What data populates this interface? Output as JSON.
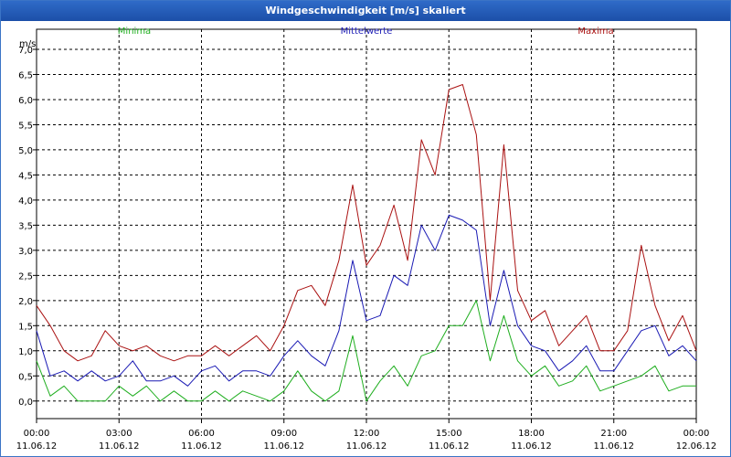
{
  "window": {
    "title": "Windgeschwindigkeit [m/s] skaliert"
  },
  "chart_data": {
    "type": "line",
    "title": "Windgeschwindigkeit [m/s] skaliert",
    "ylabel": "m/s",
    "xlabel": "",
    "xlim": [
      0,
      24
    ],
    "ylim": [
      -0.35,
      7.4
    ],
    "grid": true,
    "legend_placement": "top",
    "y_ticks": [
      "0,0",
      "0,5",
      "1,0",
      "1,5",
      "2,0",
      "2,5",
      "3,0",
      "3,5",
      "4,0",
      "4,5",
      "5,0",
      "5,5",
      "6,0",
      "6,5",
      "7,0"
    ],
    "y_tick_values": [
      0,
      0.5,
      1,
      1.5,
      2,
      2.5,
      3,
      3.5,
      4,
      4.5,
      5,
      5.5,
      6,
      6.5,
      7
    ],
    "x_ticks": [
      {
        "time": "00:00",
        "date": "11.06.12",
        "hour": 0
      },
      {
        "time": "03:00",
        "date": "11.06.12",
        "hour": 3
      },
      {
        "time": "06:00",
        "date": "11.06.12",
        "hour": 6
      },
      {
        "time": "09:00",
        "date": "11.06.12",
        "hour": 9
      },
      {
        "time": "12:00",
        "date": "11.06.12",
        "hour": 12
      },
      {
        "time": "15:00",
        "date": "11.06.12",
        "hour": 15
      },
      {
        "time": "18:00",
        "date": "11.06.12",
        "hour": 18
      },
      {
        "time": "21:00",
        "date": "11.06.12",
        "hour": 21
      },
      {
        "time": "00:00",
        "date": "12.06.12",
        "hour": 24
      }
    ],
    "x": [
      0,
      0.5,
      1,
      1.5,
      2,
      2.5,
      3,
      3.5,
      4,
      4.5,
      5,
      5.5,
      6,
      6.5,
      7,
      7.5,
      8,
      8.5,
      9,
      9.5,
      10,
      10.5,
      11,
      11.5,
      12,
      12.5,
      13,
      13.5,
      14,
      14.5,
      15,
      15.5,
      16,
      16.5,
      17,
      17.5,
      18,
      18.5,
      19,
      19.5,
      20,
      20.5,
      21,
      21.5,
      22,
      22.5,
      23,
      23.5,
      24
    ],
    "series": [
      {
        "name": "Minima",
        "color": "#1fae1f",
        "values": [
          0.8,
          0.1,
          0.3,
          0,
          0,
          0,
          0.3,
          0.1,
          0.3,
          0,
          0.2,
          0,
          0,
          0.2,
          0,
          0.2,
          0.1,
          0,
          0.2,
          0.6,
          0.2,
          0,
          0.2,
          1.3,
          0,
          0.4,
          0.7,
          0.3,
          0.9,
          1,
          1.5,
          1.5,
          2,
          0.8,
          1.7,
          0.8,
          0.5,
          0.7,
          0.3,
          0.4,
          0.7,
          0.2,
          0.3,
          0.4,
          0.5,
          0.7,
          0.2,
          0.3,
          0.3
        ]
      },
      {
        "name": "Mittelwerte",
        "color": "#1a1ab4",
        "values": [
          1.4,
          0.5,
          0.6,
          0.4,
          0.6,
          0.4,
          0.5,
          0.8,
          0.4,
          0.4,
          0.5,
          0.3,
          0.6,
          0.7,
          0.4,
          0.6,
          0.6,
          0.5,
          0.9,
          1.2,
          0.9,
          0.7,
          1.4,
          2.8,
          1.6,
          1.7,
          2.5,
          2.3,
          3.5,
          3,
          3.7,
          3.6,
          3.4,
          1.5,
          2.6,
          1.5,
          1.1,
          1,
          0.6,
          0.8,
          1.1,
          0.6,
          0.6,
          1,
          1.4,
          1.5,
          0.9,
          1.1,
          0.8
        ]
      },
      {
        "name": "Maxima",
        "color": "#aa1111",
        "values": [
          1.9,
          1.5,
          1,
          0.8,
          0.9,
          1.4,
          1.1,
          1,
          1.1,
          0.9,
          0.8,
          0.9,
          0.9,
          1.1,
          0.9,
          1.1,
          1.3,
          1,
          1.5,
          2.2,
          2.3,
          1.9,
          2.8,
          4.3,
          2.7,
          3.1,
          3.9,
          2.8,
          5.2,
          4.5,
          6.2,
          6.3,
          5.3,
          2,
          5.1,
          2.2,
          1.6,
          1.8,
          1.1,
          1.4,
          1.7,
          1,
          1,
          1.4,
          3.1,
          1.9,
          1.2,
          1.7,
          1
        ]
      }
    ]
  }
}
